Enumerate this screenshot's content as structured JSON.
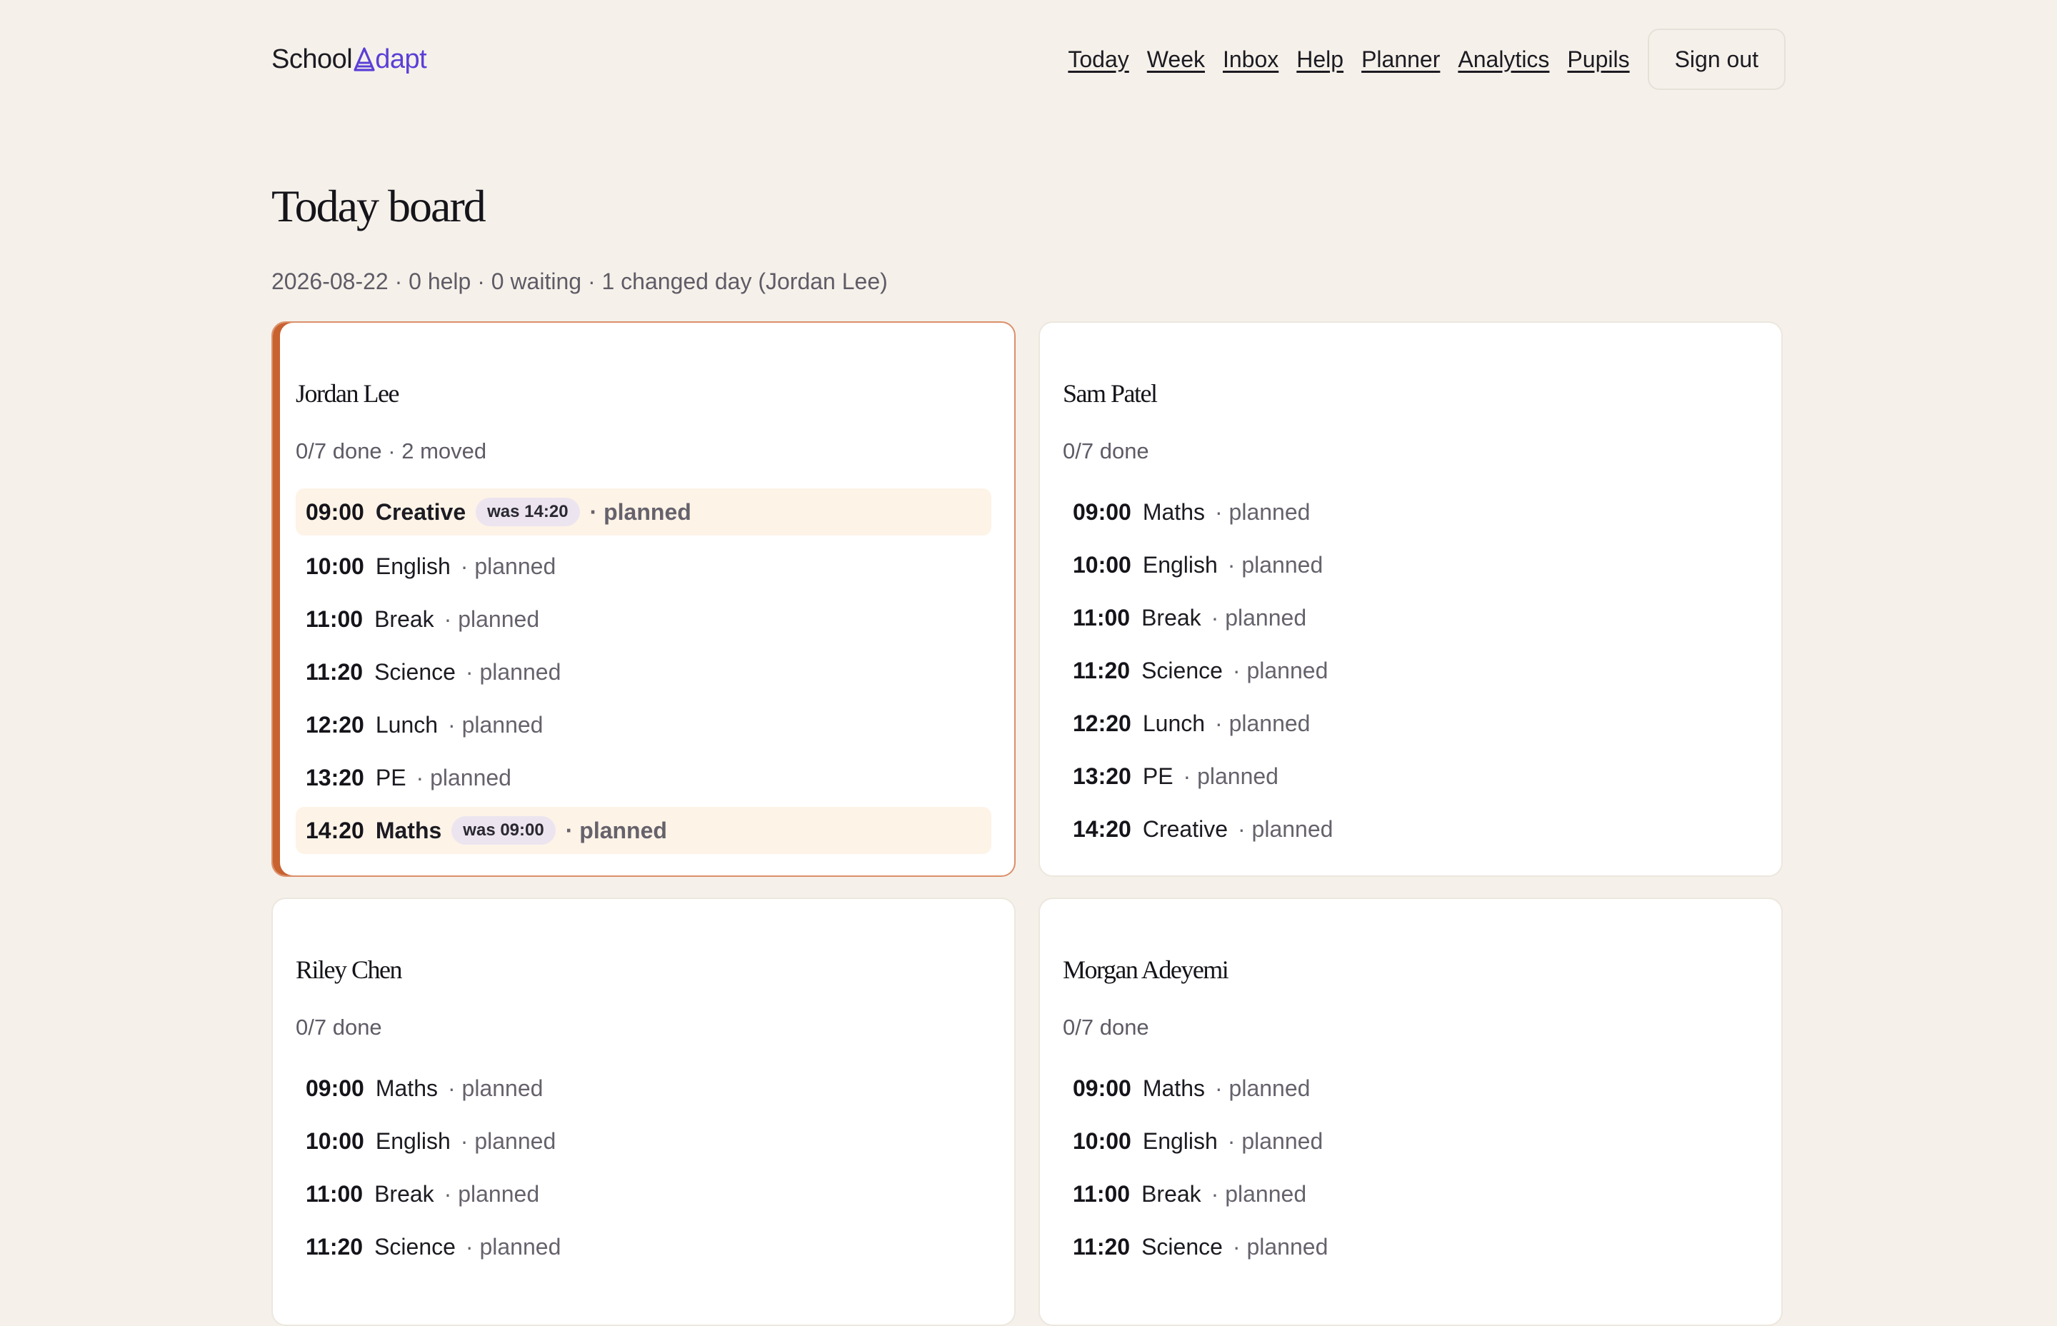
{
  "app": {
    "logo_school": "School",
    "logo_adapt": "dapt"
  },
  "nav": {
    "items": [
      "Today",
      "Week",
      "Inbox",
      "Help",
      "Planner",
      "Analytics",
      "Pupils"
    ],
    "sign_out": "Sign out"
  },
  "page": {
    "title": "Today board",
    "summary": "2026-08-22 · 0 help · 0 waiting · 1 changed day (Jordan Lee)"
  },
  "colors": {
    "background": "#f5f1ea",
    "brand": "#5a3fd6",
    "changed_accent": "#c8622f",
    "moved_highlight": "#fdf3e7"
  },
  "pupils": [
    {
      "name": "Jordan Lee",
      "meta": "0/7 done · 2 moved",
      "changed": true,
      "slots": [
        {
          "time": "09:00",
          "subject": "Creative",
          "was": "was 14:20",
          "status": "· planned",
          "moved": true
        },
        {
          "time": "10:00",
          "subject": "English",
          "was": "",
          "status": "· planned",
          "moved": false
        },
        {
          "time": "11:00",
          "subject": "Break",
          "was": "",
          "status": "· planned",
          "moved": false
        },
        {
          "time": "11:20",
          "subject": "Science",
          "was": "",
          "status": "· planned",
          "moved": false
        },
        {
          "time": "12:20",
          "subject": "Lunch",
          "was": "",
          "status": "· planned",
          "moved": false
        },
        {
          "time": "13:20",
          "subject": "PE",
          "was": "",
          "status": "· planned",
          "moved": false
        },
        {
          "time": "14:20",
          "subject": "Maths",
          "was": "was 09:00",
          "status": "· planned",
          "moved": true
        }
      ]
    },
    {
      "name": "Sam Patel",
      "meta": "0/7 done",
      "changed": false,
      "slots": [
        {
          "time": "09:00",
          "subject": "Maths",
          "was": "",
          "status": "· planned",
          "moved": false
        },
        {
          "time": "10:00",
          "subject": "English",
          "was": "",
          "status": "· planned",
          "moved": false
        },
        {
          "time": "11:00",
          "subject": "Break",
          "was": "",
          "status": "· planned",
          "moved": false
        },
        {
          "time": "11:20",
          "subject": "Science",
          "was": "",
          "status": "· planned",
          "moved": false
        },
        {
          "time": "12:20",
          "subject": "Lunch",
          "was": "",
          "status": "· planned",
          "moved": false
        },
        {
          "time": "13:20",
          "subject": "PE",
          "was": "",
          "status": "· planned",
          "moved": false
        },
        {
          "time": "14:20",
          "subject": "Creative",
          "was": "",
          "status": "· planned",
          "moved": false
        }
      ]
    },
    {
      "name": "Riley Chen",
      "meta": "0/7 done",
      "changed": false,
      "slots": [
        {
          "time": "09:00",
          "subject": "Maths",
          "was": "",
          "status": "· planned",
          "moved": false
        },
        {
          "time": "10:00",
          "subject": "English",
          "was": "",
          "status": "· planned",
          "moved": false
        },
        {
          "time": "11:00",
          "subject": "Break",
          "was": "",
          "status": "· planned",
          "moved": false
        },
        {
          "time": "11:20",
          "subject": "Science",
          "was": "",
          "status": "· planned",
          "moved": false
        }
      ]
    },
    {
      "name": "Morgan Adeyemi",
      "meta": "0/7 done",
      "changed": false,
      "slots": [
        {
          "time": "09:00",
          "subject": "Maths",
          "was": "",
          "status": "· planned",
          "moved": false
        },
        {
          "time": "10:00",
          "subject": "English",
          "was": "",
          "status": "· planned",
          "moved": false
        },
        {
          "time": "11:00",
          "subject": "Break",
          "was": "",
          "status": "· planned",
          "moved": false
        },
        {
          "time": "11:20",
          "subject": "Science",
          "was": "",
          "status": "· planned",
          "moved": false
        }
      ]
    }
  ]
}
